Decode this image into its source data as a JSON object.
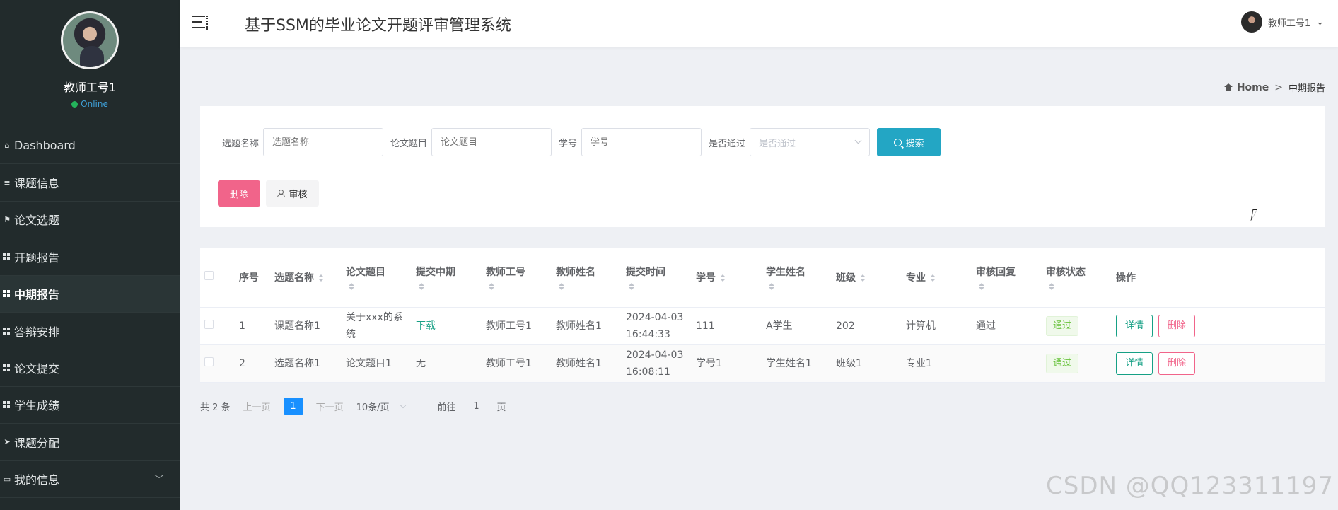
{
  "sidebar": {
    "profile_name": "教师工号1",
    "status": "Online",
    "items": [
      {
        "label": "Dashboard",
        "icon": "home-icon"
      },
      {
        "label": "课题信息",
        "icon": "list-icon"
      },
      {
        "label": "论文选题",
        "icon": "flag-icon"
      },
      {
        "label": "开题报告",
        "icon": "grid-icon"
      },
      {
        "label": "中期报告",
        "icon": "grid-icon"
      },
      {
        "label": "答辩安排",
        "icon": "grid-icon"
      },
      {
        "label": "论文提交",
        "icon": "grid-icon"
      },
      {
        "label": "学生成绩",
        "icon": "grid-icon"
      },
      {
        "label": "课题分配",
        "icon": "send-icon"
      },
      {
        "label": "我的信息",
        "icon": "card-icon"
      }
    ]
  },
  "header": {
    "title": "基于SSM的毕业论文开题评审管理系统",
    "user": "教师工号1"
  },
  "breadcrumb": {
    "home": "Home",
    "separator": ">",
    "current": "中期报告"
  },
  "search": {
    "topic_label": "选题名称",
    "topic_placeholder": "选题名称",
    "paper_label": "论文题目",
    "paper_placeholder": "论文题目",
    "sid_label": "学号",
    "sid_placeholder": "学号",
    "pass_label": "是否通过",
    "pass_placeholder": "是否通过",
    "search_button": "搜索"
  },
  "actions": {
    "delete": "删除",
    "audit": "审核"
  },
  "table": {
    "headers": {
      "index": "序号",
      "topic": "选题名称",
      "paper": "论文题目",
      "submit_mid": "提交中期",
      "teacher_id": "教师工号",
      "teacher_name": "教师姓名",
      "submit_time": "提交时间",
      "student_id": "学号",
      "student_name": "学生姓名",
      "class": "班级",
      "major": "专业",
      "reply": "审核回复",
      "status": "审核状态",
      "ops": "操作"
    },
    "rows": [
      {
        "index": "1",
        "topic": "课题名称1",
        "paper": "关于xxx的系统",
        "submit_mid": "下载",
        "teacher_id": "教师工号1",
        "teacher_name": "教师姓名1",
        "submit_date": "2024-04-03",
        "submit_clock": "16:44:33",
        "student_id": "111",
        "student_name": "A学生",
        "class": "202",
        "major": "计算机",
        "reply": "通过",
        "status": "通过",
        "detail": "详情",
        "delete": "删除"
      },
      {
        "index": "2",
        "topic": "选题名称1",
        "paper": "论文题目1",
        "submit_mid": "无",
        "teacher_id": "教师工号1",
        "teacher_name": "教师姓名1",
        "submit_date": "2024-04-03",
        "submit_clock": "16:08:11",
        "student_id": "学号1",
        "student_name": "学生姓名1",
        "class": "班级1",
        "major": "专业1",
        "reply": "",
        "status": "通过",
        "detail": "详情",
        "delete": "删除"
      }
    ]
  },
  "pagination": {
    "total": "共 2 条",
    "prev": "上一页",
    "current": "1",
    "next": "下一页",
    "page_size": "10条/页",
    "goto_prefix": "前往",
    "goto_value": "1",
    "goto_suffix": "页"
  },
  "watermark": "CSDN @QQ123311197",
  "colors": {
    "sidebar_bg": "#222b2c",
    "primary": "#23a6c4",
    "danger": "#f1648a",
    "success_text": "#16a085",
    "page_active": "#1890ff"
  }
}
